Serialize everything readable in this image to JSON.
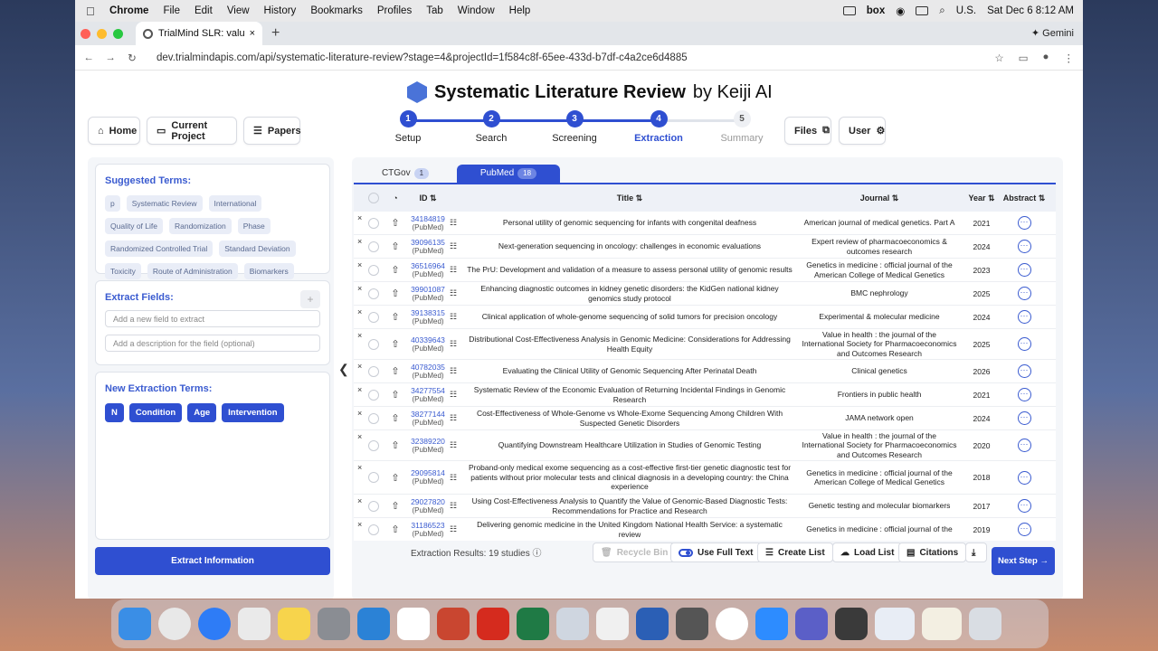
{
  "menubar": {
    "apple": "",
    "items": [
      "Chrome",
      "File",
      "Edit",
      "View",
      "History",
      "Bookmarks",
      "Profiles",
      "Tab",
      "Window",
      "Help"
    ],
    "box": "box",
    "input": "U.S.",
    "clock": "Sat Dec 6  8:12 AM"
  },
  "browser": {
    "tab_title": "TrialMind SLR: value of genom",
    "new_tab": "+",
    "gemini": "✦ Gemini",
    "url": "dev.trialmindapis.com/api/systematic-literature-review?stage=4&projectId=1f584c8f-65ee-433d-b7df-c4a2ce6d4885"
  },
  "header": {
    "title": "Systematic Literature Review",
    "by": "by Keiji AI",
    "home": "Home",
    "current_project": "Current Project",
    "papers": "Papers",
    "files": "Files",
    "user": "User"
  },
  "steps": [
    {
      "num": "1",
      "label": "Setup"
    },
    {
      "num": "2",
      "label": "Search"
    },
    {
      "num": "3",
      "label": "Screening"
    },
    {
      "num": "4",
      "label": "Extraction"
    },
    {
      "num": "5",
      "label": "Summary"
    }
  ],
  "suggested": {
    "title": "Suggested Terms:",
    "terms": [
      "p",
      "Systematic Review",
      "International",
      "Quality of Life",
      "Randomization",
      "Phase",
      "Randomized Controlled Trial",
      "Standard Deviation",
      "Toxicity",
      "Route of Administration",
      "Biomarkers"
    ]
  },
  "extract_fields": {
    "title": "Extract Fields:",
    "plus": "+",
    "field_placeholder": "Add a new field to extract",
    "desc_placeholder": "Add a description for the field (optional)"
  },
  "new_terms": {
    "title": "New Extraction Terms:",
    "tags": [
      "N",
      "Condition",
      "Age",
      "Intervention"
    ]
  },
  "extract_button": "Extract Information",
  "collapse": "❮",
  "sources": {
    "ctgov": "CTGov",
    "ctgov_count": "1",
    "pubmed": "PubMed",
    "pubmed_count": "18"
  },
  "table": {
    "headers": {
      "id": "ID ⇅",
      "title": "Title ⇅",
      "journal": "Journal ⇅",
      "year": "Year ⇅",
      "abstract": "Abstract ⇅"
    },
    "rows": [
      {
        "id": "34184819",
        "src": "(PubMed)",
        "title": "Personal utility of genomic sequencing for infants with congenital deafness",
        "journal": "American journal of medical genetics. Part A",
        "year": "2021"
      },
      {
        "id": "39096135",
        "src": "(PubMed)",
        "title": "Next-generation sequencing in oncology: challenges in economic evaluations",
        "journal": "Expert review of pharmacoeconomics & outcomes research",
        "year": "2024"
      },
      {
        "id": "36516964",
        "src": "(PubMed)",
        "title": "The PrU: Development and validation of a measure to assess personal utility of genomic results",
        "journal": "Genetics in medicine : official journal of the American College of Medical Genetics",
        "year": "2023"
      },
      {
        "id": "39901087",
        "src": "(PubMed)",
        "title": "Enhancing diagnostic outcomes in kidney genetic disorders: the KidGen national kidney genomics study protocol",
        "journal": "BMC nephrology",
        "year": "2025"
      },
      {
        "id": "39138315",
        "src": "(PubMed)",
        "title": "Clinical application of whole-genome sequencing of solid tumors for precision oncology",
        "journal": "Experimental & molecular medicine",
        "year": "2024"
      },
      {
        "id": "40339643",
        "src": "(PubMed)",
        "title": "Distributional Cost-Effectiveness Analysis in Genomic Medicine: Considerations for Addressing Health Equity",
        "journal": "Value in health : the journal of the International Society for Pharmacoeconomics and Outcomes Research",
        "year": "2025"
      },
      {
        "id": "40782035",
        "src": "(PubMed)",
        "title": "Evaluating the Clinical Utility of Genomic Sequencing After Perinatal Death",
        "journal": "Clinical genetics",
        "year": "2026"
      },
      {
        "id": "34277554",
        "src": "(PubMed)",
        "title": "Systematic Review of the Economic Evaluation of Returning Incidental Findings in Genomic Research",
        "journal": "Frontiers in public health",
        "year": "2021"
      },
      {
        "id": "38277144",
        "src": "(PubMed)",
        "title": "Cost-Effectiveness of Whole-Genome vs Whole-Exome Sequencing Among Children With Suspected Genetic Disorders",
        "journal": "JAMA network open",
        "year": "2024"
      },
      {
        "id": "32389220",
        "src": "(PubMed)",
        "title": "Quantifying Downstream Healthcare Utilization in Studies of Genomic Testing",
        "journal": "Value in health : the journal of the International Society for Pharmacoeconomics and Outcomes Research",
        "year": "2020"
      },
      {
        "id": "29095814",
        "src": "(PubMed)",
        "title": "Proband-only medical exome sequencing as a cost-effective first-tier genetic diagnostic test for patients without prior molecular tests and clinical diagnosis in a developing country: the China experience",
        "journal": "Genetics in medicine : official journal of the American College of Medical Genetics",
        "year": "2018"
      },
      {
        "id": "29027820",
        "src": "(PubMed)",
        "title": "Using Cost-Effectiveness Analysis to Quantify the Value of Genomic-Based Diagnostic Tests: Recommendations for Practice and Research",
        "journal": "Genetic testing and molecular biomarkers",
        "year": "2017"
      },
      {
        "id": "31186523",
        "src": "(PubMed)",
        "title": "Delivering genomic medicine in the United Kingdom National Health Service: a systematic review",
        "journal": "Genetics in medicine : official journal of the",
        "year": "2019"
      }
    ]
  },
  "footer": {
    "results": "Extraction Results: 19 studies",
    "recycle": "Recycle Bin",
    "full_text": "Use Full Text",
    "create_list": "Create List",
    "load_list": "Load List",
    "citations": "Citations",
    "next": "Next Step →"
  },
  "colors": {
    "accent": "#2f4fd1",
    "link": "#3a5bd0"
  }
}
